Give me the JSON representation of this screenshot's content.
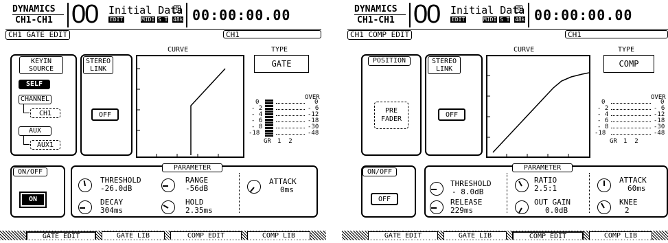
{
  "left": {
    "header": {
      "dyn_title": "DYNAMICS",
      "channel": "CH1-CH1",
      "scene": "00",
      "scene_title": "Initial Data",
      "edit_badge": "EDIT",
      "midi": "MIDI",
      "st": "S T",
      "rate": "48k",
      "timecode": "00:00:00.00",
      "b_icon": "B"
    },
    "page_title": "CH1 GATE EDIT",
    "channel_name": "CH1",
    "keyin": {
      "title": "KEYIN SOURCE",
      "self": "SELF",
      "channel": "CHANNEL",
      "channel_val": "CH1",
      "aux": "AUX",
      "aux_val": "AUX1"
    },
    "stereo": {
      "title": "STEREO LINK",
      "btn": "OFF"
    },
    "curve_label": "CURVE",
    "type_label": "TYPE",
    "type_value": "GATE",
    "meter": {
      "scale": [
        "0",
        "- 2",
        "- 4",
        "- 6",
        "- 8",
        "-18"
      ],
      "right": [
        "OVER",
        "0",
        "- 6",
        "-12",
        "-18",
        "-30",
        "-48"
      ],
      "gr": "GR",
      "chs": "1  2"
    },
    "onoff": {
      "title": "ON/OFF",
      "btn": "ON"
    },
    "param_title": "PARAMETER",
    "params": [
      {
        "name": "THRESHOLD",
        "value": "-26.0dB"
      },
      {
        "name": "RANGE",
        "value": "-56dB"
      },
      {
        "name": "ATTACK",
        "value": "0ms"
      },
      {
        "name": "DECAY",
        "value": "304ms"
      },
      {
        "name": "HOLD",
        "value": "2.35ms"
      }
    ],
    "tabs": [
      "GATE EDIT",
      "GATE LIB",
      "COMP EDIT",
      "COMP LIB"
    ]
  },
  "right": {
    "header": {
      "dyn_title": "DYNAMICS",
      "channel": "CH1-CH1",
      "scene": "00",
      "scene_title": "Initial Data",
      "edit_badge": "EDIT",
      "midi": "MIDI",
      "st": "S T",
      "rate": "48k",
      "timecode": "00:00:00.00",
      "b_icon": "B"
    },
    "page_title": "CH1 COMP EDIT",
    "channel_name": "CH1",
    "position": {
      "title": "POSITION",
      "btn_line1": "PRE",
      "btn_line2": "FADER"
    },
    "stereo": {
      "title": "STEREO LINK",
      "btn": "OFF"
    },
    "curve_label": "CURVE",
    "type_label": "TYPE",
    "type_value": "COMP",
    "meter": {
      "scale": [
        "0",
        "- 2",
        "- 4",
        "- 6",
        "- 8",
        "-18"
      ],
      "right": [
        "OVER",
        "0",
        "- 6",
        "-12",
        "-18",
        "-30",
        "-48"
      ],
      "gr": "GR",
      "chs": "1  2"
    },
    "onoff": {
      "title": "ON/OFF",
      "btn": "OFF"
    },
    "param_title": "PARAMETER",
    "params": [
      {
        "name": "THRESHOLD",
        "value": "- 8.0dB"
      },
      {
        "name": "RATIO",
        "value": "2.5:1"
      },
      {
        "name": "ATTACK",
        "value": "60ms"
      },
      {
        "name": "RELEASE",
        "value": "229ms"
      },
      {
        "name": "OUT GAIN",
        "value": "0.0dB"
      },
      {
        "name": "KNEE",
        "value": "2"
      }
    ],
    "tabs": [
      "GATE EDIT",
      "GATE LIB",
      "COMP EDIT",
      "COMP LIB"
    ]
  }
}
